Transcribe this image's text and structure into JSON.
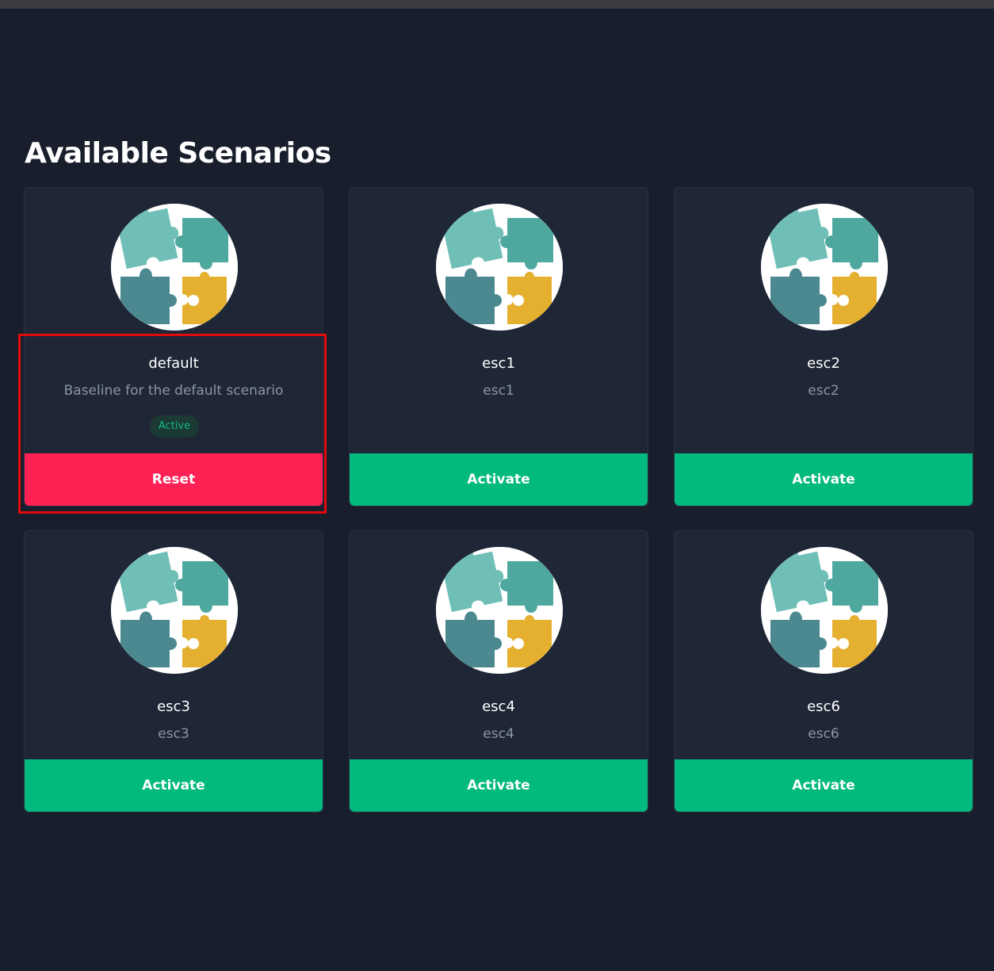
{
  "page": {
    "title": "Available Scenarios"
  },
  "icons": {
    "scenario_avatar": "puzzle-pieces-icon"
  },
  "colors": {
    "background": "#181e2b",
    "card": "#1f2736",
    "activate": "#02b97e",
    "reset": "#ff2054",
    "active_badge_text": "#10b981",
    "highlight": "#e10b0b"
  },
  "scenarios": [
    {
      "name": "default",
      "description": "Baseline for the default scenario",
      "status": "Active",
      "action": "Reset"
    },
    {
      "name": "esc1",
      "description": "esc1",
      "action": "Activate"
    },
    {
      "name": "esc2",
      "description": "esc2",
      "action": "Activate"
    },
    {
      "name": "esc3",
      "description": "esc3",
      "action": "Activate"
    },
    {
      "name": "esc4",
      "description": "esc4",
      "action": "Activate"
    },
    {
      "name": "esc6",
      "description": "esc6",
      "action": "Activate"
    }
  ]
}
